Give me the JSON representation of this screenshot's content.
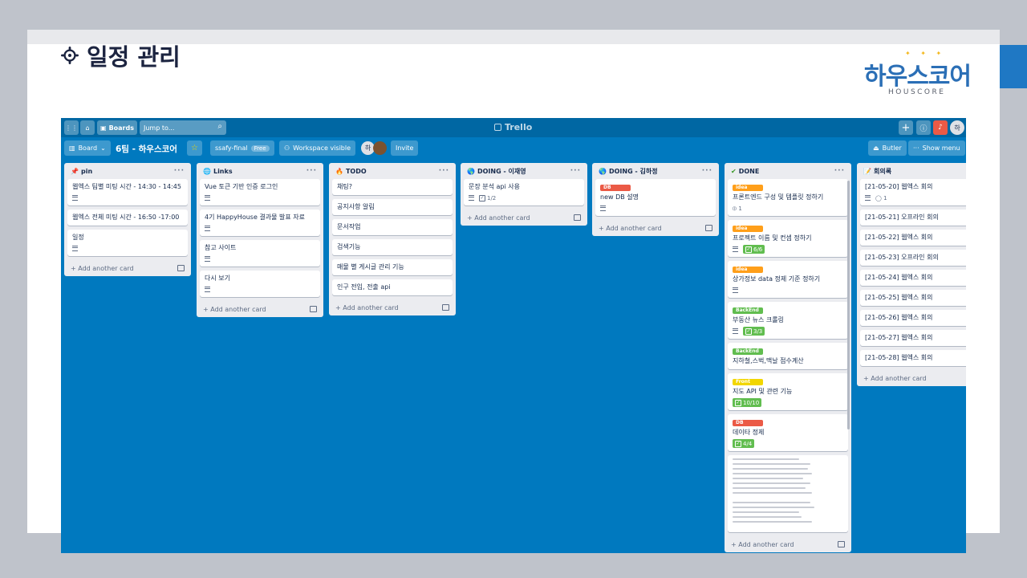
{
  "slide": {
    "title": "일정 관리",
    "logo_text": "하우스코어",
    "logo_sub": "HOUSCORE",
    "accent_color": "#1f78c4"
  },
  "trello": {
    "brand": "Trello",
    "topbar": {
      "boards_label": "Boards",
      "search_placeholder": "Jump to...",
      "avatar_initial": "하"
    },
    "boardbar": {
      "board_view": "Board",
      "board_name": "6팀 - 하우스코어",
      "workspace": "ssafy-final",
      "workspace_badge": "Free",
      "visibility": "Workspace visible",
      "member_initial": "하",
      "invite": "Invite",
      "butler": "Butler",
      "show_menu": "Show menu"
    },
    "colors": {
      "board_bg": "#0079bf",
      "list_bg": "#ebecf0",
      "label_idea": "#ff9f1a",
      "label_backend": "#61bd4f",
      "label_front": "#f2d600",
      "label_db": "#eb5a46"
    },
    "add_card_label": "Add another card",
    "lists": [
      {
        "title": "pin",
        "icon": "pushpin-icon",
        "cards": [
          {
            "text": "웹엑스 팀별 미팅 시간 - 14:30 - 14:45",
            "desc": true
          },
          {
            "text": "웹엑스 전체 미팅 시간 - 16:50 -17:00"
          },
          {
            "text": "일정",
            "desc": true
          }
        ]
      },
      {
        "title": "Links",
        "icon": "globe-icon",
        "cards": [
          {
            "text": "Vue 토큰 기반 인증 로그인",
            "desc": true
          },
          {
            "text": "4기 HappyHouse 결과물 발표 자료",
            "desc": true
          },
          {
            "text": "참고 사이트",
            "desc": true
          },
          {
            "text": "다시 보기",
            "desc": true
          }
        ]
      },
      {
        "title": "TODO",
        "icon": "fire-icon",
        "cards": [
          {
            "text": "채팅?"
          },
          {
            "text": "공지사항 알림"
          },
          {
            "text": "문서작업"
          },
          {
            "text": "검색기능"
          },
          {
            "text": "매물 별 게시글 관리 기능"
          },
          {
            "text": "인구 전입, 전출 api"
          }
        ]
      },
      {
        "title": "DOING - 이재영",
        "icon": "earth-icon",
        "cards": [
          {
            "text": "문장 분석 api 사용",
            "desc": true,
            "checklist": "1/2"
          }
        ]
      },
      {
        "title": "DOING - 김하정",
        "icon": "earth-icon",
        "cards": [
          {
            "label": "DB",
            "label_key": "label_db",
            "text": "new DB 설명",
            "desc": true
          }
        ]
      },
      {
        "title": "DONE",
        "icon": "check-icon",
        "cards": [
          {
            "label": "idea",
            "label_key": "label_idea",
            "text": "프론트엔드 구성 및 템플릿 정하기",
            "attach": "1"
          },
          {
            "label": "idea",
            "label_key": "label_idea",
            "text": "프로젝트 이름 및 컨셉 정하기",
            "desc": true,
            "checklist": "6/6",
            "complete": true
          },
          {
            "label": "idea",
            "label_key": "label_idea",
            "text": "상가정보 data 정제 기준 정하기",
            "desc": true
          },
          {
            "label": "BackEnd",
            "label_key": "label_backend",
            "text": "부동산 뉴스 크롤링",
            "desc": true,
            "checklist": "3/3",
            "complete": true
          },
          {
            "label": "BackEnd",
            "label_key": "label_backend",
            "text": "지하철,스벅,맥날 점수계산"
          },
          {
            "label": "Front",
            "label_key": "label_front",
            "text": "지도 API 및 관련 기능",
            "checklist": "10/10",
            "complete": true
          },
          {
            "label": "DB",
            "label_key": "label_db",
            "text": "데이타 정제",
            "checklist": "4/4",
            "complete": true
          },
          {
            "code": true
          }
        ]
      },
      {
        "title": "회의록",
        "icon": "memo-icon",
        "cards": [
          {
            "text": "[21-05-20] 웹엑스 회의",
            "desc": true,
            "comments": "1"
          },
          {
            "text": "[21-05-21] 오프라인 회의"
          },
          {
            "text": "[21-05-22] 웹엑스 회의"
          },
          {
            "text": "[21-05-23] 오프라인 회의"
          },
          {
            "text": "[21-05-24] 웹엑스 회의"
          },
          {
            "text": "[21-05-25] 웹엑스 회의"
          },
          {
            "text": "[21-05-26] 웹엑스 회의"
          },
          {
            "text": "[21-05-27] 웹엑스 회의"
          },
          {
            "text": "[21-05-28] 웹엑스 회의"
          }
        ]
      }
    ]
  }
}
